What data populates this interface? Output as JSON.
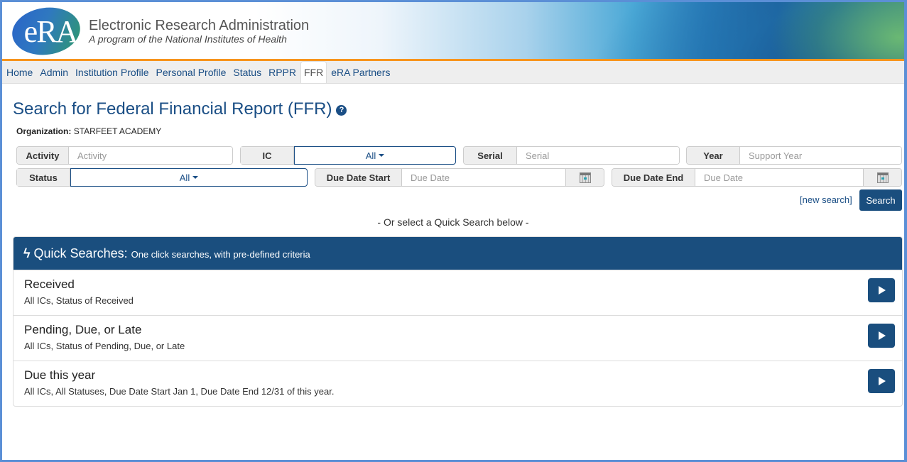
{
  "header": {
    "logo_text": "eRA",
    "title": "Electronic Research Administration",
    "subtitle": "A program of the National Institutes of Health"
  },
  "nav": {
    "items": [
      {
        "label": "Home",
        "active": false
      },
      {
        "label": "Admin",
        "active": false
      },
      {
        "label": "Institution Profile",
        "active": false
      },
      {
        "label": "Personal Profile",
        "active": false
      },
      {
        "label": "Status",
        "active": false
      },
      {
        "label": "RPPR",
        "active": false
      },
      {
        "label": "FFR",
        "active": true
      },
      {
        "label": "eRA Partners",
        "active": false
      }
    ]
  },
  "page": {
    "title": "Search for Federal Financial Report (FFR)",
    "help_icon": "?",
    "org_label": "Organization:",
    "org_value": "STARFEET ACADEMY"
  },
  "search": {
    "activity": {
      "label": "Activity",
      "placeholder": "Activity",
      "value": ""
    },
    "ic": {
      "label": "IC",
      "value": "All"
    },
    "serial": {
      "label": "Serial",
      "placeholder": "Serial",
      "value": ""
    },
    "year": {
      "label": "Year",
      "placeholder": "Support Year",
      "value": ""
    },
    "status": {
      "label": "Status",
      "value": "All"
    },
    "due_start": {
      "label": "Due Date Start",
      "placeholder": "Due Date",
      "value": ""
    },
    "due_end": {
      "label": "Due Date End",
      "placeholder": "Due Date",
      "value": ""
    },
    "new_search_label": "[new search]",
    "search_label": "Search",
    "or_text": "- Or select a Quick Search below -"
  },
  "quick_searches": {
    "icon": "bolt-icon",
    "title": "Quick Searches:",
    "subtitle": "One click searches, with pre-defined criteria",
    "items": [
      {
        "name": "Received",
        "desc": "All ICs, Status of Received"
      },
      {
        "name": "Pending, Due, or Late",
        "desc": "All ICs, Status of Pending, Due, or Late"
      },
      {
        "name": "Due this year",
        "desc": "All ICs, All Statuses, Due Date Start Jan 1, Due Date End 12/31 of this year."
      }
    ]
  },
  "colors": {
    "brand_blue": "#1a4e7e",
    "link_blue": "#1a4e85",
    "accent_orange": "#f7941d"
  }
}
